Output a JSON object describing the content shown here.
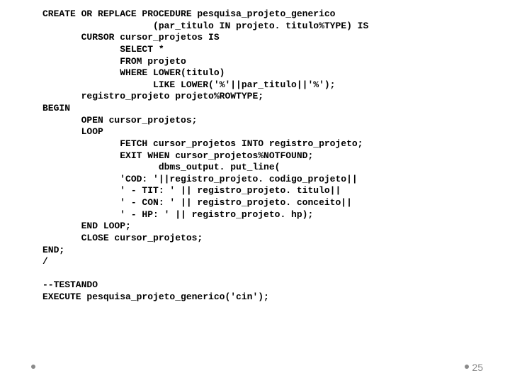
{
  "code": "CREATE OR REPLACE PROCEDURE pesquisa_projeto_generico\n                    (par_titulo IN projeto. titulo%TYPE) IS\n       CURSOR cursor_projetos IS\n              SELECT *\n              FROM projeto\n              WHERE LOWER(titulo)\n                    LIKE LOWER('%'||par_titulo||'%');\n       registro_projeto projeto%ROWTYPE;\nBEGIN\n       OPEN cursor_projetos;\n       LOOP\n              FETCH cursor_projetos INTO registro_projeto;\n              EXIT WHEN cursor_projetos%NOTFOUND;\n                     dbms_output. put_line(\n              'COD: '||registro_projeto. codigo_projeto||\n              ' - TIT: ' || registro_projeto. titulo||\n              ' - CON: ' || registro_projeto. conceito||\n              ' - HP: ' || registro_projeto. hp);\n       END LOOP;\n       CLOSE cursor_projetos;\nEND;\n/\n\n--TESTANDO\nEXECUTE pesquisa_projeto_generico('cin');",
  "page_number": "25"
}
